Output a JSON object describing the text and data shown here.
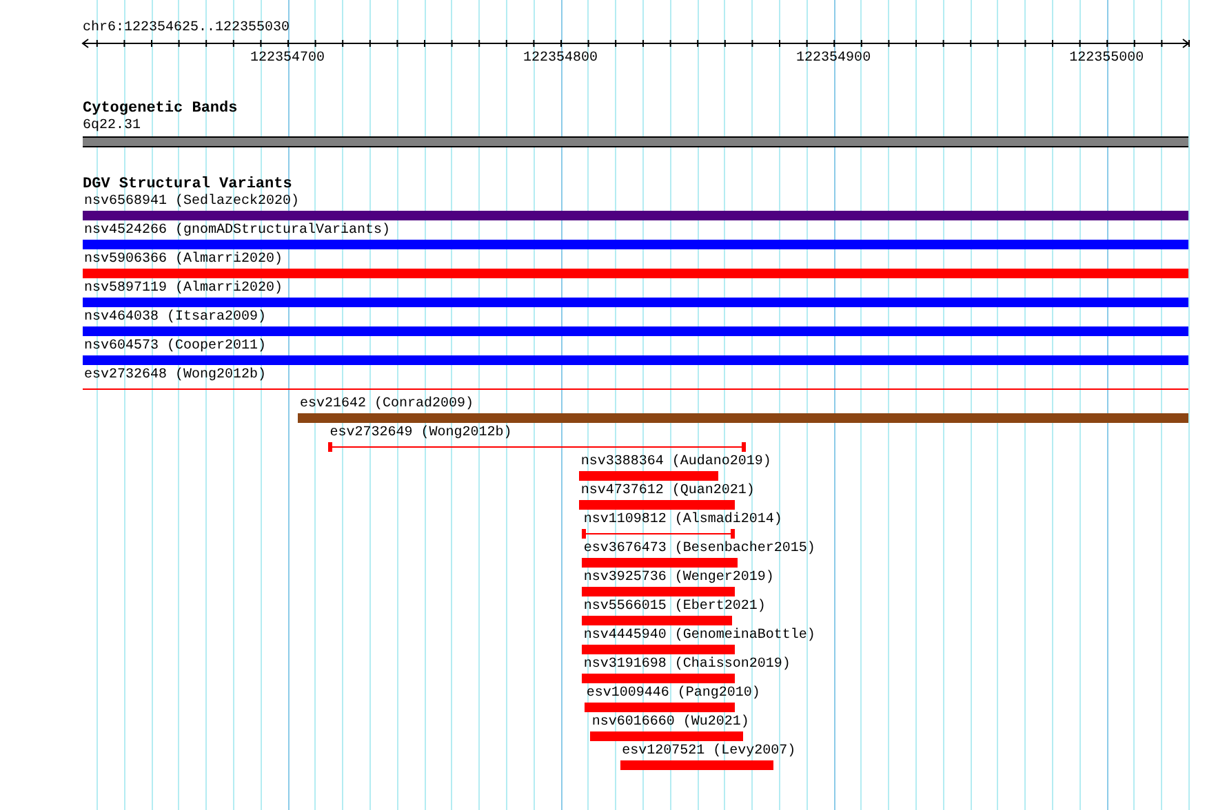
{
  "ruler": {
    "location": "chr6:122354625..122355030",
    "tick_labels": [
      "122354700",
      "122354800",
      "122354900",
      "122355000"
    ]
  },
  "cytobands": {
    "title": "Cytogenetic Bands",
    "band": {
      "label": "6q22.31",
      "color": "#808080"
    }
  },
  "variants": {
    "title": "DGV Structural Variants",
    "features": [
      {
        "label": "nsv6568941 (Sedlazeck2020)",
        "kind": "bar",
        "color": "#4f0080"
      },
      {
        "label": "nsv4524266 (gnomADStructuralVariants)",
        "kind": "bar",
        "color": "#0000ff"
      },
      {
        "label": "nsv5906366 (Almarri2020)",
        "kind": "bar",
        "color": "#ff0000"
      },
      {
        "label": "nsv5897119 (Almarri2020)",
        "kind": "bar",
        "color": "#0000ff"
      },
      {
        "label": "nsv464038 (Itsara2009)",
        "kind": "bar",
        "color": "#0000ff"
      },
      {
        "label": "nsv604573 (Cooper2011)",
        "kind": "bar",
        "color": "#0000ff"
      },
      {
        "label": "esv2732648 (Wong2012b)",
        "kind": "line",
        "color": "#ff0000"
      },
      {
        "label": "esv21642 (Conrad2009)",
        "kind": "bar",
        "color": "#8b4513"
      },
      {
        "label": "esv2732649 (Wong2012b)",
        "kind": "line",
        "color": "#ff0000"
      },
      {
        "label": "nsv3388364 (Audano2019)",
        "kind": "bar",
        "color": "#ff0000"
      },
      {
        "label": "nsv4737612 (Quan2021)",
        "kind": "bar",
        "color": "#ff0000"
      },
      {
        "label": "nsv1109812 (Alsmadi2014)",
        "kind": "line",
        "color": "#ff0000"
      },
      {
        "label": "esv3676473 (Besenbacher2015)",
        "kind": "bar",
        "color": "#ff0000"
      },
      {
        "label": "nsv3925736 (Wenger2019)",
        "kind": "bar",
        "color": "#ff0000"
      },
      {
        "label": "nsv5566015 (Ebert2021)",
        "kind": "bar",
        "color": "#ff0000"
      },
      {
        "label": "nsv4445940 (GenomeinaBottle)",
        "kind": "bar",
        "color": "#ff0000"
      },
      {
        "label": "nsv3191698 (Chaisson2019)",
        "kind": "bar",
        "color": "#ff0000"
      },
      {
        "label": "esv1009446 (Pang2010)",
        "kind": "bar",
        "color": "#ff0000"
      },
      {
        "label": "nsv6016660 (Wu2021)",
        "kind": "bar",
        "color": "#ff0000"
      },
      {
        "label": "esv1207521 (Levy2007)",
        "kind": "bar",
        "color": "#ff0000"
      }
    ]
  }
}
